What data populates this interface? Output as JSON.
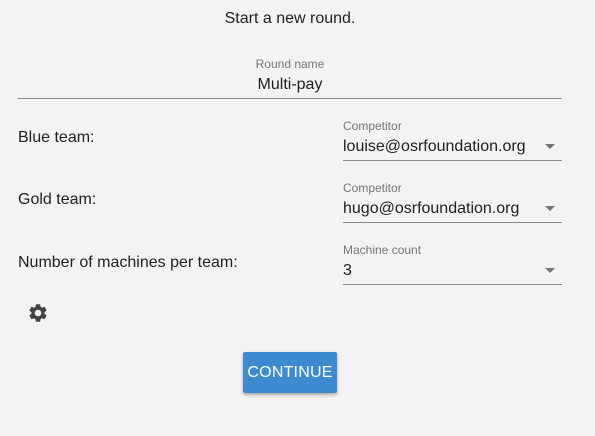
{
  "heading": "Start a new round.",
  "round": {
    "label": "Round name",
    "value": "Multi-pay"
  },
  "blue": {
    "row_label": "Blue team:",
    "field_label": "Competitor",
    "value": "louise@osrfoundation.org"
  },
  "gold": {
    "row_label": "Gold team:",
    "field_label": "Competitor",
    "value": "hugo@osrfoundation.org"
  },
  "machines": {
    "row_label": "Number of machines per team:",
    "field_label": "Machine count",
    "value": "3"
  },
  "settings_icon": "gear-icon",
  "continue_label": "CONTINUE",
  "colors": {
    "button": "#3d8ad1",
    "background": "#f3f3f3"
  }
}
